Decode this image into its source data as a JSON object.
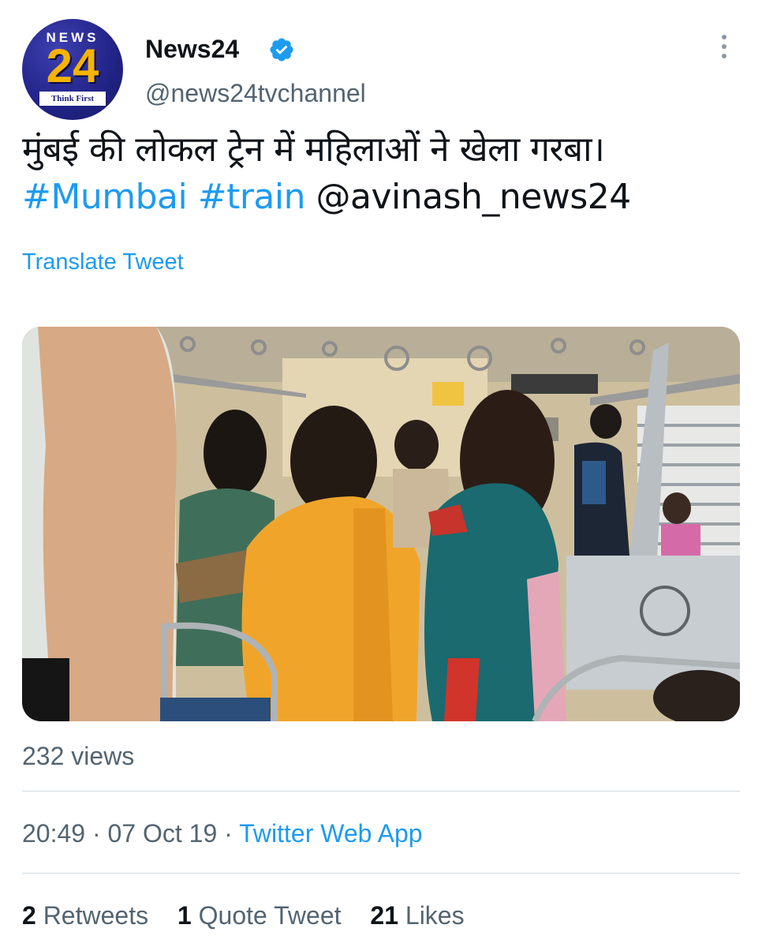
{
  "author": {
    "avatar": {
      "logo_top": "NEWS",
      "logo_number": "24",
      "logo_tagline": "Think First"
    },
    "name": "News24",
    "handle": "@news24tvchannel",
    "verified": true
  },
  "tweet": {
    "text": "मुंबई की लोकल ट्रेन में महिलाओं ने खेला गरबा।",
    "hashtags": [
      "#Mumbai",
      "#train"
    ],
    "mention": "@avinash_news24",
    "translate_label": "Translate Tweet"
  },
  "media": {
    "type": "video"
  },
  "views": "232 views",
  "meta": {
    "time": "20:49",
    "separator": "·",
    "date": "07 Oct 19",
    "source": "Twitter Web App"
  },
  "engagement": {
    "retweets_count": "2",
    "retweets_label": "Retweets",
    "quotes_count": "1",
    "quotes_label": "Quote Tweet",
    "likes_count": "21",
    "likes_label": "Likes"
  },
  "colors": {
    "link": "#1d9bf0",
    "secondary_text": "#536471",
    "primary_text": "#0f1419",
    "divider": "#cfd9de"
  }
}
